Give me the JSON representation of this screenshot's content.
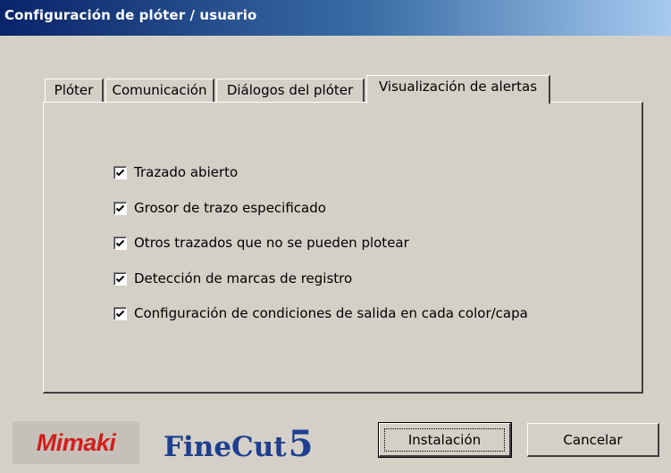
{
  "window": {
    "title": "Configuración de plóter / usuario"
  },
  "tabs": [
    {
      "label": "Plóter"
    },
    {
      "label": "Comunicación"
    },
    {
      "label": "Diálogos del plóter"
    },
    {
      "label": "Visualización de alertas",
      "active": true
    }
  ],
  "options": [
    {
      "label": "Trazado abierto",
      "checked": true
    },
    {
      "label": "Grosor de trazo especificado",
      "checked": true
    },
    {
      "label": "Otros trazados que no se pueden plotear",
      "checked": true
    },
    {
      "label": "Detección de marcas de registro",
      "checked": true
    },
    {
      "label": "Configuración de condiciones de salida en cada color/capa",
      "checked": true
    }
  ],
  "branding": {
    "mimaki": "Mimaki",
    "finecut": "FineCut",
    "finecut_version": "5"
  },
  "buttons": {
    "install": "Instalación",
    "cancel": "Cancelar"
  }
}
